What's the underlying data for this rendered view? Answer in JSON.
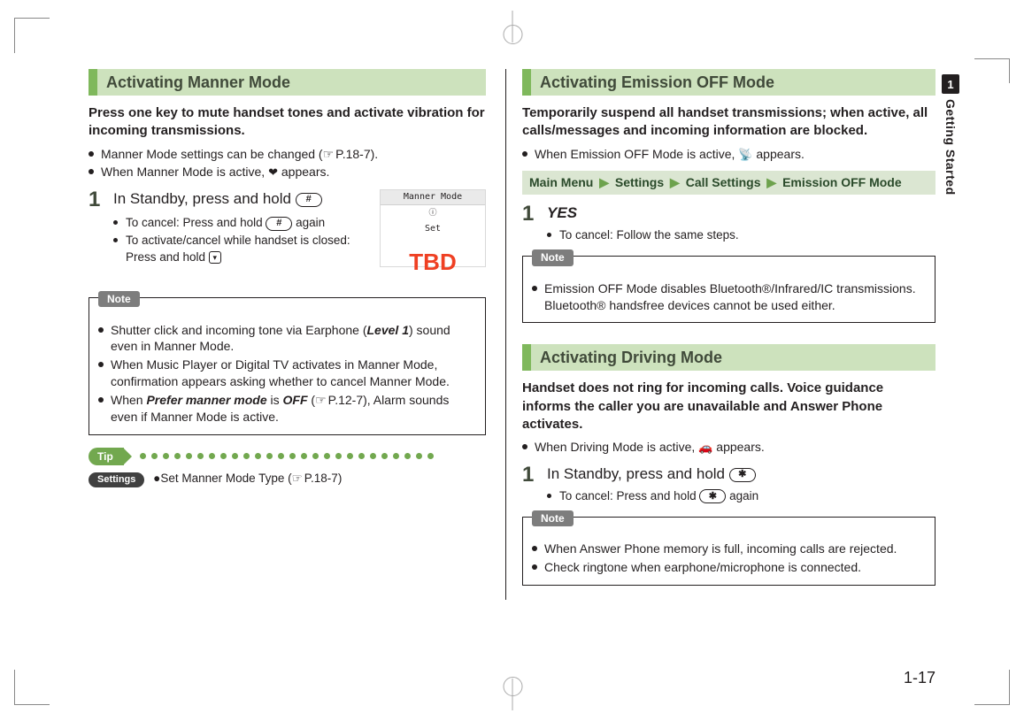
{
  "side": {
    "chapter_num": "1",
    "chapter_title": "Getting Started"
  },
  "page_number": "1-17",
  "left": {
    "section_title": "Activating Manner Mode",
    "intro": "Press one key to mute handset tones and activate vibration for incoming transmissions.",
    "bullets": [
      {
        "pre": "Manner Mode settings can be changed (",
        "ref": "P.18-7",
        "post": ")."
      },
      {
        "pre": "When Manner Mode is active, ",
        "icon": "❤",
        "post": " appears."
      }
    ],
    "step1": {
      "num": "1",
      "text_pre": "In Standby, press and hold ",
      "key": "#",
      "sub": [
        {
          "pre": "To cancel: Press and hold ",
          "key": "#",
          "post": " again"
        },
        {
          "pre": "To activate/cancel while handset is closed: Press and hold ",
          "smallkey": "▾",
          "post": ""
        }
      ]
    },
    "thumb": {
      "title": "Manner Mode",
      "sub": "Set",
      "tbd": "TBD"
    },
    "note_label": "Note",
    "note_items": [
      {
        "parts": [
          "Shutter click and incoming tone via Earphone (",
          {
            "bi": "Level 1"
          },
          ") sound even in Manner Mode."
        ]
      },
      {
        "parts": [
          "When Music Player or Digital TV activates in Manner Mode, confirmation appears asking whether to cancel Manner Mode."
        ]
      },
      {
        "parts": [
          "When ",
          {
            "bi": "Prefer manner mode"
          },
          " is ",
          {
            "bi": "OFF"
          },
          " (",
          {
            "ref": "P.12-7"
          },
          "), Alarm sounds even if Manner Mode is active."
        ]
      }
    ],
    "tip_label": "Tip",
    "settings_pill": "Settings",
    "tip_text_pre": "●Set Manner Mode Type (",
    "tip_ref": "P.18-7",
    "tip_text_post": ")"
  },
  "right": {
    "sec1": {
      "title": "Activating Emission OFF Mode",
      "intro": "Temporarily suspend all handset transmissions; when active, all calls/messages and incoming information are blocked.",
      "bullet_pre": "When Emission OFF Mode is active, ",
      "bullet_icon": "📡",
      "bullet_post": " appears.",
      "menu": [
        "Main Menu",
        "Settings",
        "Call Settings",
        "Emission OFF Mode"
      ],
      "step_num": "1",
      "step_word": "YES",
      "step_sub": "To cancel: Follow the same steps.",
      "note_label": "Note",
      "note_text": "Emission OFF Mode disables Bluetooth®/Infrared/IC transmissions. Bluetooth® handsfree devices cannot be used either."
    },
    "sec2": {
      "title": "Activating Driving Mode",
      "intro": "Handset does not ring for incoming calls. Voice guidance informs the caller you are unavailable and Answer Phone activates.",
      "bullet_pre": "When Driving Mode is active, ",
      "bullet_icon": "🚗",
      "bullet_post": " appears.",
      "step_num": "1",
      "step_text_pre": "In Standby, press and hold ",
      "step_key": "✱",
      "step_sub_pre": "To cancel: Press and hold ",
      "step_sub_key": "✱",
      "step_sub_post": " again",
      "note_label": "Note",
      "note_items": [
        "When Answer Phone memory is full, incoming calls are rejected.",
        "Check ringtone when earphone/microphone is connected."
      ]
    }
  }
}
